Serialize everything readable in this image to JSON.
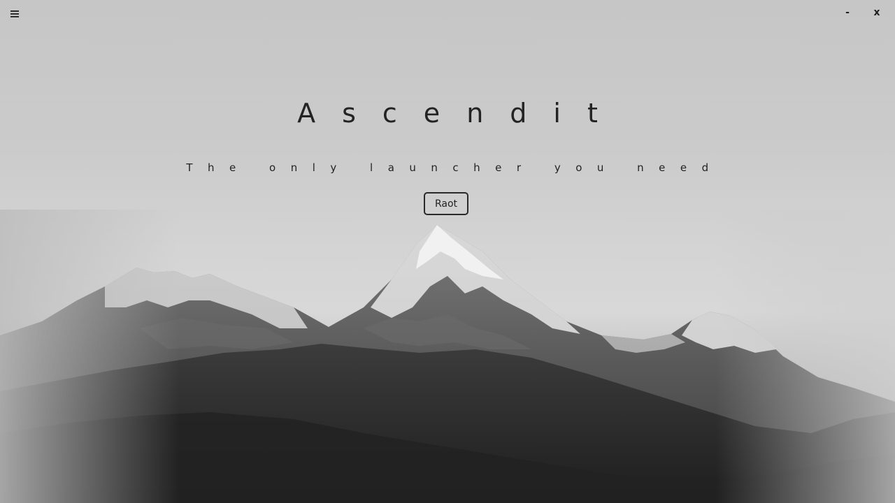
{
  "window": {
    "menu_icon": "hamburger-menu-icon",
    "minimize_label": "-",
    "close_label": "x"
  },
  "hero": {
    "title": "Ascendit",
    "subtitle": "The only launcher you need"
  },
  "actions": {
    "launch_label": "Raot"
  },
  "background": {
    "subject": "grayscale snow-capped mountain range"
  }
}
